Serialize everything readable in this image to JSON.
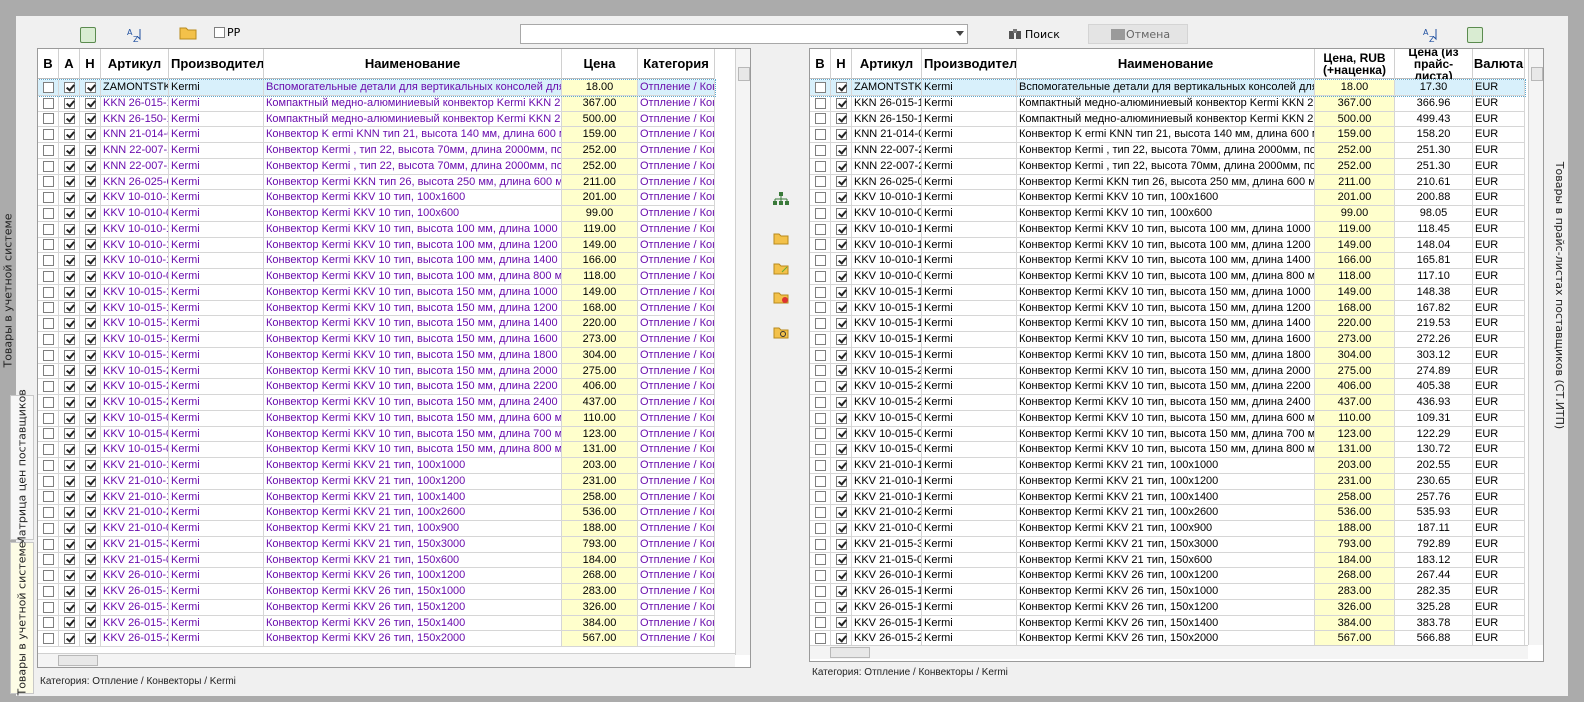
{
  "side_tabs": {
    "left_top": "Товары в учетной системе",
    "left_middle": "Матрица цен поставщиков",
    "left_bottom": "Товары в учетной системе",
    "right": "Товары в прайс-листах поставщиков (СТ.ИТП)"
  },
  "toolbar": {
    "checkbox_label": "РР",
    "search_label": "Поиск",
    "cancel_label": "Отмена",
    "combo_value": ""
  },
  "left_grid": {
    "headers": [
      "В",
      "А",
      "Н",
      "Артикул",
      "Производитель",
      "Наименование",
      "Цена",
      "Категория"
    ],
    "rows": [
      {
        "b": false,
        "a": true,
        "n": true,
        "art": "ZAMONTSTK",
        "mfr": "Kermi",
        "name": "Вспомогательные детали для вертикальных консолей для",
        "price": "18.00",
        "cat": "Отпление / Конвек"
      },
      {
        "b": false,
        "a": true,
        "n": true,
        "art": "KKN 26-015-1",
        "mfr": "Kermi",
        "name": "Компактный медно-алюминиевый конвектор Kermi KKN 26-",
        "price": "367.00",
        "cat": "Отпление / Конвек"
      },
      {
        "b": false,
        "a": true,
        "n": true,
        "art": "KKN 26-150-1",
        "mfr": "Kermi",
        "name": "Компактный медно-алюминиевый конвектор Kermi KKN 26-",
        "price": "500.00",
        "cat": "Отпление / Конвек"
      },
      {
        "b": false,
        "a": true,
        "n": true,
        "art": "KNN 21-014-0",
        "mfr": "Kermi",
        "name": "Конвектор K ermi KNN тип  21, высота 140 мм, длина 600 м",
        "price": "159.00",
        "cat": "Отпление / Конвек"
      },
      {
        "b": false,
        "a": true,
        "n": true,
        "art": "KNN 22-007-2",
        "mfr": "Kermi",
        "name": "Конвектор  Kermi  , тип 22, высота 70мм, длина 2000мм, под",
        "price": "252.00",
        "cat": "Отпление / Конвек"
      },
      {
        "b": false,
        "a": true,
        "n": true,
        "art": "KNN 22-007-2",
        "mfr": "Kermi",
        "name": "Конвектор  Kermi  , тип 22, высота 70мм, длина 2000мм, под",
        "price": "252.00",
        "cat": "Отпление / Конвек"
      },
      {
        "b": false,
        "a": true,
        "n": true,
        "art": "KKN 26-025-0",
        "mfr": "Kermi",
        "name": "Конвектор Kermi  KKN тип 26, высота 250 мм, длина 600 мм",
        "price": "211.00",
        "cat": "Отпление / Конвек"
      },
      {
        "b": false,
        "a": true,
        "n": true,
        "art": "KKV 10-010-1",
        "mfr": "Kermi",
        "name": "Конвектор Kermi KKV 10 тип, 100x1600",
        "price": "201.00",
        "cat": "Отпление / Конвек"
      },
      {
        "b": false,
        "a": true,
        "n": true,
        "art": "KKV 10-010-0",
        "mfr": "Kermi",
        "name": "Конвектор Kermi KKV 10 тип, 100x600",
        "price": "99.00",
        "cat": "Отпление / Конвек"
      },
      {
        "b": false,
        "a": true,
        "n": true,
        "art": "KKV 10-010-1",
        "mfr": "Kermi",
        "name": "Конвектор Kermi KKV 10 тип, высота 100 мм, длина 1000 мм",
        "price": "119.00",
        "cat": "Отпление / Конвек"
      },
      {
        "b": false,
        "a": true,
        "n": true,
        "art": "KKV 10-010-1",
        "mfr": "Kermi",
        "name": "Конвектор Kermi KKV 10 тип, высота 100 мм, длина 1200 мм",
        "price": "149.00",
        "cat": "Отпление / Конвек"
      },
      {
        "b": false,
        "a": true,
        "n": true,
        "art": "KKV 10-010-1",
        "mfr": "Kermi",
        "name": "Конвектор Kermi KKV 10 тип, высота 100 мм, длина 1400 мм",
        "price": "166.00",
        "cat": "Отпление / Конвек"
      },
      {
        "b": false,
        "a": true,
        "n": true,
        "art": "KKV 10-010-0",
        "mfr": "Kermi",
        "name": "Конвектор Kermi KKV 10 тип, высота 100 мм, длина 800 мм",
        "price": "118.00",
        "cat": "Отпление / Конвек"
      },
      {
        "b": false,
        "a": true,
        "n": true,
        "art": "KKV 10-015-1",
        "mfr": "Kermi",
        "name": "Конвектор Kermi KKV 10 тип, высота 150 мм, длина 1000 мм",
        "price": "149.00",
        "cat": "Отпление / Конвек"
      },
      {
        "b": false,
        "a": true,
        "n": true,
        "art": "KKV 10-015-1",
        "mfr": "Kermi",
        "name": "Конвектор Kermi KKV 10 тип, высота 150 мм, длина 1200 мм",
        "price": "168.00",
        "cat": "Отпление / Конвек"
      },
      {
        "b": false,
        "a": true,
        "n": true,
        "art": "KKV 10-015-1",
        "mfr": "Kermi",
        "name": "Конвектор Kermi KKV 10 тип, высота 150 мм, длина 1400 мм",
        "price": "220.00",
        "cat": "Отпление / Конвек"
      },
      {
        "b": false,
        "a": true,
        "n": true,
        "art": "KKV 10-015-1",
        "mfr": "Kermi",
        "name": "Конвектор Kermi KKV 10 тип, высота 150 мм, длина 1600 мм",
        "price": "273.00",
        "cat": "Отпление / Конвек"
      },
      {
        "b": false,
        "a": true,
        "n": true,
        "art": "KKV 10-015-1",
        "mfr": "Kermi",
        "name": "Конвектор Kermi KKV 10 тип, высота 150 мм, длина 1800 мм",
        "price": "304.00",
        "cat": "Отпление / Конвек"
      },
      {
        "b": false,
        "a": true,
        "n": true,
        "art": "KKV 10-015-2",
        "mfr": "Kermi",
        "name": "Конвектор Kermi KKV 10 тип, высота 150 мм, длина 2000 мм",
        "price": "275.00",
        "cat": "Отпление / Конвек"
      },
      {
        "b": false,
        "a": true,
        "n": true,
        "art": "KKV 10-015-2",
        "mfr": "Kermi",
        "name": "Конвектор Kermi KKV 10 тип, высота 150 мм, длина 2200 мм",
        "price": "406.00",
        "cat": "Отпление / Конвек"
      },
      {
        "b": false,
        "a": true,
        "n": true,
        "art": "KKV 10-015-2",
        "mfr": "Kermi",
        "name": "Конвектор Kermi KKV 10 тип, высота 150 мм, длина 2400 мм",
        "price": "437.00",
        "cat": "Отпление / Конвек"
      },
      {
        "b": false,
        "a": true,
        "n": true,
        "art": "KKV 10-015-0",
        "mfr": "Kermi",
        "name": "Конвектор Kermi KKV 10 тип, высота 150 мм, длина 600 мм",
        "price": "110.00",
        "cat": "Отпление / Конвек"
      },
      {
        "b": false,
        "a": true,
        "n": true,
        "art": "KKV 10-015-0",
        "mfr": "Kermi",
        "name": "Конвектор Kermi KKV 10 тип, высота 150 мм, длина 700 мм",
        "price": "123.00",
        "cat": "Отпление / Конвек"
      },
      {
        "b": false,
        "a": true,
        "n": true,
        "art": "KKV 10-015-0",
        "mfr": "Kermi",
        "name": "Конвектор Kermi KKV 10 тип, высота 150 мм, длина 800 мм",
        "price": "131.00",
        "cat": "Отпление / Конвек"
      },
      {
        "b": false,
        "a": true,
        "n": true,
        "art": "KKV 21-010-1",
        "mfr": "Kermi",
        "name": "Конвектор Kermi KKV 21 тип, 100x1000",
        "price": "203.00",
        "cat": "Отпление / Конвек"
      },
      {
        "b": false,
        "a": true,
        "n": true,
        "art": "KKV 21-010-1",
        "mfr": "Kermi",
        "name": "Конвектор Kermi KKV 21 тип, 100x1200",
        "price": "231.00",
        "cat": "Отпление / Конвек"
      },
      {
        "b": false,
        "a": true,
        "n": true,
        "art": "KKV 21-010-1",
        "mfr": "Kermi",
        "name": "Конвектор Kermi KKV 21 тип, 100x1400",
        "price": "258.00",
        "cat": "Отпление / Конвек"
      },
      {
        "b": false,
        "a": true,
        "n": true,
        "art": "KKV 21-010-2",
        "mfr": "Kermi",
        "name": "Конвектор Kermi KKV 21 тип, 100x2600",
        "price": "536.00",
        "cat": "Отпление / Конвек"
      },
      {
        "b": false,
        "a": true,
        "n": true,
        "art": "KKV 21-010-0",
        "mfr": "Kermi",
        "name": "Конвектор Kermi KKV 21 тип, 100x900",
        "price": "188.00",
        "cat": "Отпление / Конвек"
      },
      {
        "b": false,
        "a": true,
        "n": true,
        "art": "KKV 21-015-3",
        "mfr": "Kermi",
        "name": "Конвектор Kermi KKV 21 тип, 150x3000",
        "price": "793.00",
        "cat": "Отпление / Конвек"
      },
      {
        "b": false,
        "a": true,
        "n": true,
        "art": "KKV 21-015-0",
        "mfr": "Kermi",
        "name": "Конвектор Kermi KKV 21 тип, 150x600",
        "price": "184.00",
        "cat": "Отпление / Конвек"
      },
      {
        "b": false,
        "a": true,
        "n": true,
        "art": "KKV 26-010-1",
        "mfr": "Kermi",
        "name": "Конвектор Kermi KKV 26 тип, 100x1200",
        "price": "268.00",
        "cat": "Отпление / Конвек"
      },
      {
        "b": false,
        "a": true,
        "n": true,
        "art": "KKV 26-015-1",
        "mfr": "Kermi",
        "name": "Конвектор Kermi KKV 26 тип, 150x1000",
        "price": "283.00",
        "cat": "Отпление / Конвек"
      },
      {
        "b": false,
        "a": true,
        "n": true,
        "art": "KKV 26-015-1",
        "mfr": "Kermi",
        "name": "Конвектор Kermi KKV 26 тип, 150x1200",
        "price": "326.00",
        "cat": "Отпление / Конвек"
      },
      {
        "b": false,
        "a": true,
        "n": true,
        "art": "KKV 26-015-1",
        "mfr": "Kermi",
        "name": "Конвектор Kermi KKV 26 тип, 150x1400",
        "price": "384.00",
        "cat": "Отпление / Конвек"
      },
      {
        "b": false,
        "a": true,
        "n": true,
        "art": "KKV 26-015-2",
        "mfr": "Kermi",
        "name": "Конвектор Kermi KKV 26 тип, 150x2000",
        "price": "567.00",
        "cat": "Отпление / Конвек"
      }
    ],
    "status": "Категория: Отпление / Конвекторы / Kermi"
  },
  "right_grid": {
    "headers": [
      "В",
      "Н",
      "Артикул",
      "Производитель",
      "Наименование",
      "Цена, RUB (+наценка)",
      "Цена (из прайс-листа)",
      "Валюта"
    ],
    "rows": [
      {
        "b": false,
        "n": true,
        "art": "ZAMONTSTK",
        "mfr": "Kermi",
        "name": "Вспомогательные детали для вертикальных консолей для",
        "price": "18.00",
        "pl": "17.30",
        "cur": "EUR"
      },
      {
        "b": false,
        "n": true,
        "art": "KKN 26-015-1",
        "mfr": "Kermi",
        "name": "Компактный медно-алюминиевый конвектор Kermi KKN 26-",
        "price": "367.00",
        "pl": "366.96",
        "cur": "EUR"
      },
      {
        "b": false,
        "n": true,
        "art": "KKN 26-150-1",
        "mfr": "Kermi",
        "name": "Компактный медно-алюминиевый конвектор Kermi KKN 26-",
        "price": "500.00",
        "pl": "499.43",
        "cur": "EUR"
      },
      {
        "b": false,
        "n": true,
        "art": "KNN 21-014-0",
        "mfr": "Kermi",
        "name": "Конвектор K ermi KNN тип  21, высота 140 мм, длина 600 м",
        "price": "159.00",
        "pl": "158.20",
        "cur": "EUR"
      },
      {
        "b": false,
        "n": true,
        "art": "KNN 22-007-2",
        "mfr": "Kermi",
        "name": "Конвектор  Kermi  , тип 22, высота 70мм, длина 2000мм, под",
        "price": "252.00",
        "pl": "251.30",
        "cur": "EUR"
      },
      {
        "b": false,
        "n": true,
        "art": "KNN 22-007-2",
        "mfr": "Kermi",
        "name": "Конвектор  Kermi  , тип 22, высота 70мм, длина 2000мм, под",
        "price": "252.00",
        "pl": "251.30",
        "cur": "EUR"
      },
      {
        "b": false,
        "n": true,
        "art": "KKN 26-025-0",
        "mfr": "Kermi",
        "name": "Конвектор Kermi  KKN тип 26, высота 250 мм, длина 600 мм",
        "price": "211.00",
        "pl": "210.61",
        "cur": "EUR"
      },
      {
        "b": false,
        "n": true,
        "art": "KKV 10-010-1",
        "mfr": "Kermi",
        "name": "Конвектор Kermi KKV 10 тип, 100x1600",
        "price": "201.00",
        "pl": "200.88",
        "cur": "EUR"
      },
      {
        "b": false,
        "n": true,
        "art": "KKV 10-010-0",
        "mfr": "Kermi",
        "name": "Конвектор Kermi KKV 10 тип, 100x600",
        "price": "99.00",
        "pl": "98.05",
        "cur": "EUR"
      },
      {
        "b": false,
        "n": true,
        "art": "KKV 10-010-1",
        "mfr": "Kermi",
        "name": "Конвектор Kermi KKV 10 тип, высота 100 мм, длина 1000 мм",
        "price": "119.00",
        "pl": "118.45",
        "cur": "EUR"
      },
      {
        "b": false,
        "n": true,
        "art": "KKV 10-010-1",
        "mfr": "Kermi",
        "name": "Конвектор Kermi KKV 10 тип, высота 100 мм, длина 1200 мм",
        "price": "149.00",
        "pl": "148.04",
        "cur": "EUR"
      },
      {
        "b": false,
        "n": true,
        "art": "KKV 10-010-1",
        "mfr": "Kermi",
        "name": "Конвектор Kermi KKV 10 тип, высота 100 мм, длина 1400 мм",
        "price": "166.00",
        "pl": "165.81",
        "cur": "EUR"
      },
      {
        "b": false,
        "n": true,
        "art": "KKV 10-010-0",
        "mfr": "Kermi",
        "name": "Конвектор Kermi KKV 10 тип, высота 100 мм, длина 800 мм",
        "price": "118.00",
        "pl": "117.10",
        "cur": "EUR"
      },
      {
        "b": false,
        "n": true,
        "art": "KKV 10-015-1",
        "mfr": "Kermi",
        "name": "Конвектор Kermi KKV 10 тип, высота 150 мм, длина 1000 мм",
        "price": "149.00",
        "pl": "148.38",
        "cur": "EUR"
      },
      {
        "b": false,
        "n": true,
        "art": "KKV 10-015-1",
        "mfr": "Kermi",
        "name": "Конвектор Kermi KKV 10 тип, высота 150 мм, длина 1200 мм",
        "price": "168.00",
        "pl": "167.82",
        "cur": "EUR"
      },
      {
        "b": false,
        "n": true,
        "art": "KKV 10-015-1",
        "mfr": "Kermi",
        "name": "Конвектор Kermi KKV 10 тип, высота 150 мм, длина 1400 мм",
        "price": "220.00",
        "pl": "219.53",
        "cur": "EUR"
      },
      {
        "b": false,
        "n": true,
        "art": "KKV 10-015-1",
        "mfr": "Kermi",
        "name": "Конвектор Kermi KKV 10 тип, высота 150 мм, длина 1600 мм",
        "price": "273.00",
        "pl": "272.26",
        "cur": "EUR"
      },
      {
        "b": false,
        "n": true,
        "art": "KKV 10-015-1",
        "mfr": "Kermi",
        "name": "Конвектор Kermi KKV 10 тип, высота 150 мм, длина 1800 мм",
        "price": "304.00",
        "pl": "303.12",
        "cur": "EUR"
      },
      {
        "b": false,
        "n": true,
        "art": "KKV 10-015-2",
        "mfr": "Kermi",
        "name": "Конвектор Kermi KKV 10 тип, высота 150 мм, длина 2000 мм",
        "price": "275.00",
        "pl": "274.89",
        "cur": "EUR"
      },
      {
        "b": false,
        "n": true,
        "art": "KKV 10-015-2",
        "mfr": "Kermi",
        "name": "Конвектор Kermi KKV 10 тип, высота 150 мм, длина 2200 мм",
        "price": "406.00",
        "pl": "405.38",
        "cur": "EUR"
      },
      {
        "b": false,
        "n": true,
        "art": "KKV 10-015-2",
        "mfr": "Kermi",
        "name": "Конвектор Kermi KKV 10 тип, высота 150 мм, длина 2400 мм",
        "price": "437.00",
        "pl": "436.93",
        "cur": "EUR"
      },
      {
        "b": false,
        "n": true,
        "art": "KKV 10-015-0",
        "mfr": "Kermi",
        "name": "Конвектор Kermi KKV 10 тип, высота 150 мм, длина 600 мм",
        "price": "110.00",
        "pl": "109.31",
        "cur": "EUR"
      },
      {
        "b": false,
        "n": true,
        "art": "KKV 10-015-0",
        "mfr": "Kermi",
        "name": "Конвектор Kermi KKV 10 тип, высота 150 мм, длина 700 мм",
        "price": "123.00",
        "pl": "122.29",
        "cur": "EUR"
      },
      {
        "b": false,
        "n": true,
        "art": "KKV 10-015-0",
        "mfr": "Kermi",
        "name": "Конвектор Kermi KKV 10 тип, высота 150 мм, длина 800 мм",
        "price": "131.00",
        "pl": "130.72",
        "cur": "EUR"
      },
      {
        "b": false,
        "n": true,
        "art": "KKV 21-010-1",
        "mfr": "Kermi",
        "name": "Конвектор Kermi KKV 21 тип, 100x1000",
        "price": "203.00",
        "pl": "202.55",
        "cur": "EUR"
      },
      {
        "b": false,
        "n": true,
        "art": "KKV 21-010-1",
        "mfr": "Kermi",
        "name": "Конвектор Kermi KKV 21 тип, 100x1200",
        "price": "231.00",
        "pl": "230.65",
        "cur": "EUR"
      },
      {
        "b": false,
        "n": true,
        "art": "KKV 21-010-1",
        "mfr": "Kermi",
        "name": "Конвектор Kermi KKV 21 тип, 100x1400",
        "price": "258.00",
        "pl": "257.76",
        "cur": "EUR"
      },
      {
        "b": false,
        "n": true,
        "art": "KKV 21-010-2",
        "mfr": "Kermi",
        "name": "Конвектор Kermi KKV 21 тип, 100x2600",
        "price": "536.00",
        "pl": "535.93",
        "cur": "EUR"
      },
      {
        "b": false,
        "n": true,
        "art": "KKV 21-010-0",
        "mfr": "Kermi",
        "name": "Конвектор Kermi KKV 21 тип, 100x900",
        "price": "188.00",
        "pl": "187.11",
        "cur": "EUR"
      },
      {
        "b": false,
        "n": true,
        "art": "KKV 21-015-3",
        "mfr": "Kermi",
        "name": "Конвектор Kermi KKV 21 тип, 150x3000",
        "price": "793.00",
        "pl": "792.89",
        "cur": "EUR"
      },
      {
        "b": false,
        "n": true,
        "art": "KKV 21-015-0",
        "mfr": "Kermi",
        "name": "Конвектор Kermi KKV 21 тип, 150x600",
        "price": "184.00",
        "pl": "183.12",
        "cur": "EUR"
      },
      {
        "b": false,
        "n": true,
        "art": "KKV 26-010-1",
        "mfr": "Kermi",
        "name": "Конвектор Kermi KKV 26 тип, 100x1200",
        "price": "268.00",
        "pl": "267.44",
        "cur": "EUR"
      },
      {
        "b": false,
        "n": true,
        "art": "KKV 26-015-1",
        "mfr": "Kermi",
        "name": "Конвектор Kermi KKV 26 тип, 150x1000",
        "price": "283.00",
        "pl": "282.35",
        "cur": "EUR"
      },
      {
        "b": false,
        "n": true,
        "art": "KKV 26-015-1",
        "mfr": "Kermi",
        "name": "Конвектор Kermi KKV 26 тип, 150x1200",
        "price": "326.00",
        "pl": "325.28",
        "cur": "EUR"
      },
      {
        "b": false,
        "n": true,
        "art": "KKV 26-015-1",
        "mfr": "Kermi",
        "name": "Конвектор Kermi KKV 26 тип, 150x1400",
        "price": "384.00",
        "pl": "383.78",
        "cur": "EUR"
      },
      {
        "b": false,
        "n": true,
        "art": "KKV 26-015-2",
        "mfr": "Kermi",
        "name": "Конвектор Kermi KKV 26 тип, 150x2000",
        "price": "567.00",
        "pl": "566.88",
        "cur": "EUR"
      }
    ],
    "status": "Категория: Отпление / Конвекторы / Kermi"
  }
}
